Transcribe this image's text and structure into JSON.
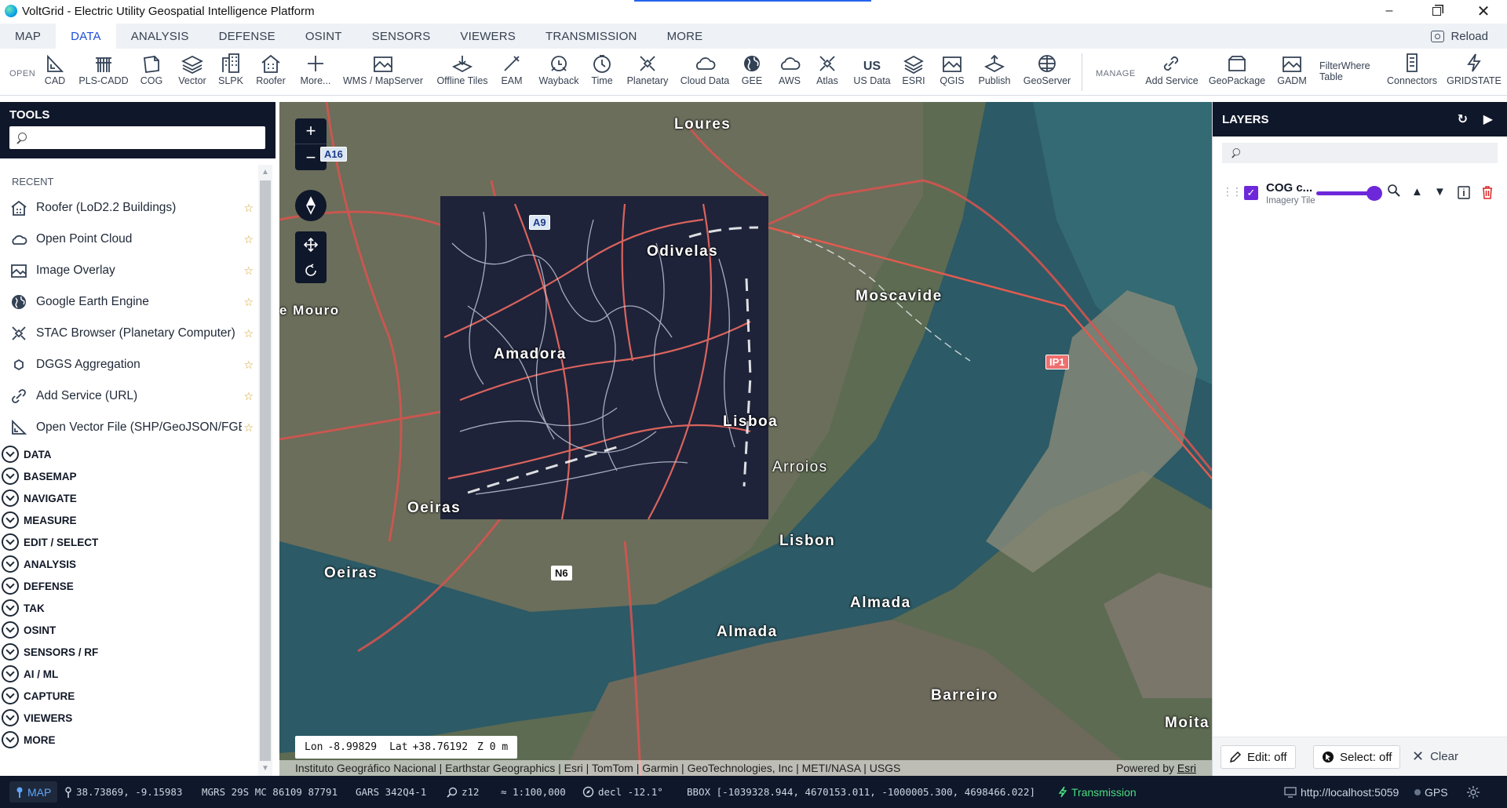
{
  "window": {
    "title": "VoltGrid - Electric Utility Geospatial Intelligence Platform",
    "controls": [
      "minimize-icon",
      "restore-icon",
      "close-icon"
    ]
  },
  "menu_tabs": [
    "MAP",
    "DATA",
    "ANALYSIS",
    "DEFENSE",
    "OSINT",
    "SENSORS",
    "VIEWERS",
    "TRANSMISSION",
    "MORE"
  ],
  "active_menu_tab": "DATA",
  "reload_label": "Reload",
  "ribbon": {
    "open_label": "OPEN",
    "manage_label": "MANAGE",
    "items": [
      {
        "label": "CAD",
        "icon": "cad-icon"
      },
      {
        "label": "PLS-CADD",
        "icon": "pls-cadd-icon"
      },
      {
        "label": "COG",
        "icon": "cog-icon"
      },
      {
        "label": "Vector",
        "icon": "vector-icon"
      },
      {
        "label": "SLPK",
        "icon": "slpk-icon"
      },
      {
        "label": "Roofer",
        "icon": "roofer-icon"
      },
      {
        "label": "More...",
        "icon": "plus-icon"
      },
      {
        "label": "WMS / MapServer",
        "icon": "wms-icon"
      },
      {
        "label": "Offline Tiles",
        "icon": "offline-tiles-icon"
      },
      {
        "label": "EAM",
        "icon": "eam-icon"
      },
      {
        "label": "Wayback",
        "icon": "wayback-icon"
      },
      {
        "label": "Time",
        "icon": "time-icon"
      },
      {
        "label": "Planetary",
        "icon": "planetary-icon"
      },
      {
        "label": "Cloud Data",
        "icon": "cloud-icon"
      },
      {
        "label": "GEE",
        "icon": "globe-icon"
      },
      {
        "label": "AWS",
        "icon": "aws-cloud-icon"
      },
      {
        "label": "Atlas",
        "icon": "atlas-icon"
      },
      {
        "label": "US Data",
        "icon": "us-data-icon",
        "glyph": "US"
      },
      {
        "label": "ESRI",
        "icon": "esri-icon"
      },
      {
        "label": "QGIS",
        "icon": "qgis-icon"
      },
      {
        "label": "Publish",
        "icon": "publish-icon"
      },
      {
        "label": "GeoServer",
        "icon": "geoserver-icon"
      }
    ],
    "manage_items": [
      {
        "label": "Add Service",
        "icon": "add-service-icon"
      },
      {
        "label": "GeoPackage",
        "icon": "geopackage-icon"
      },
      {
        "label": "GADM",
        "icon": "gadm-icon"
      },
      {
        "label_line1": "FilterWhere",
        "label_line2": "Table"
      },
      {
        "label": "Connectors",
        "icon": "connectors-icon"
      },
      {
        "label": "GRIDSTATE",
        "icon": "lightning-icon"
      }
    ]
  },
  "tools": {
    "title": "TOOLS",
    "search_placeholder": "",
    "recent_label": "RECENT",
    "recent": [
      {
        "label": "Roofer (LoD2.2 Buildings)",
        "icon": "building-icon"
      },
      {
        "label": "Open Point Cloud",
        "icon": "cloud-outline-icon"
      },
      {
        "label": "Image Overlay",
        "icon": "image-overlay-icon"
      },
      {
        "label": "Google Earth Engine",
        "icon": "globe-icon"
      },
      {
        "label": "STAC Browser (Planetary Computer)",
        "icon": "satellite-icon"
      },
      {
        "label": "DGGS Aggregation",
        "icon": "hexagon-icon"
      },
      {
        "label": "Add Service (URL)",
        "icon": "link-icon"
      },
      {
        "label": "Open Vector File (SHP/GeoJSON/FGB)",
        "icon": "vector-file-icon"
      }
    ],
    "sections": [
      "DATA",
      "BASEMAP",
      "NAVIGATE",
      "MEASURE",
      "EDIT / SELECT",
      "ANALYSIS",
      "DEFENSE",
      "TAK",
      "OSINT",
      "SENSORS / RF",
      "AI / ML",
      "CAPTURE",
      "VIEWERS",
      "MORE"
    ]
  },
  "map": {
    "controls": [
      "zoom-in-icon",
      "zoom-out-icon",
      "compass-icon",
      "pan-icon",
      "rotate-icon"
    ],
    "zoom_in": "+",
    "zoom_out": "−",
    "places": {
      "loures": "Loures",
      "odivelas": "Odivelas",
      "moscavide": "Moscavide",
      "mouro": "e Mouro",
      "amadora": "Amadora",
      "lisboa": "Lisboa",
      "arroios": "Arroios",
      "oeiras1": "Oeiras",
      "oeiras2": "Oeiras",
      "lisbon": "Lisbon",
      "almada1": "Almada",
      "almada2": "Almada",
      "barreiro": "Barreiro",
      "moita": "Moita"
    },
    "shields": {
      "a16": "A16",
      "a9": "A9",
      "ip1": "IP1",
      "n6": "N6"
    },
    "readout": {
      "lon_label": "Lon",
      "lon": "-8.99829",
      "lat_label": "Lat",
      "lat": "+38.76192",
      "z": "Z 0 m"
    },
    "attribution": "Instituto Geográfico Nacional | Earthstar Geographics | Esri | TomTom | Garmin | GeoTechnologies, Inc | METI/NASA | USGS",
    "powered_by": "Powered by",
    "powered_by_link": "Esri"
  },
  "layers": {
    "title": "LAYERS",
    "search_placeholder": "",
    "items": [
      {
        "name": "COG c...",
        "type": "Imagery Tiles",
        "visible": true,
        "opacity": 1.0
      }
    ],
    "edit_label": "Edit: off",
    "select_label": "Select: off",
    "clear_label": "Clear"
  },
  "status": {
    "mode": "MAP",
    "coords": "38.73869, -9.15983",
    "mgrs": "MGRS 29S MC 86109 87791",
    "gars": "GARS 342Q4-1",
    "zoom": "z12",
    "scale": "≈ 1:100,000",
    "decl": "decl -12.1°",
    "bbox": "BBOX [-1039328.944, 4670153.011, -1000005.300, 4698466.022]",
    "transmission": "Transmission",
    "server": "http://localhost:5059",
    "gps": "GPS"
  },
  "colors": {
    "navy": "#0f172a",
    "accent": "#1d4ed8",
    "layer_purple": "#6d28d9",
    "transmission_green": "#4ade80",
    "road_red": "#d9534f"
  }
}
